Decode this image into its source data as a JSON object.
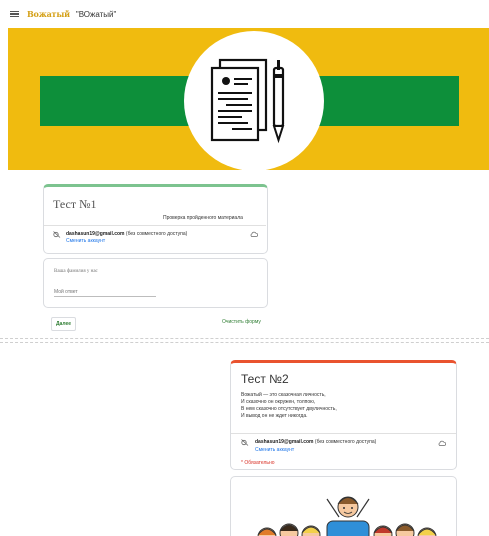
{
  "header": {
    "menu_icon": "hamburger-icon",
    "logo_text": "Вожатый",
    "title": "\"ВОжатый\""
  },
  "banner": {
    "bg_color": "#f0bb0f",
    "stripe_color": "#0d8f3a",
    "icon": "document-pen-icon"
  },
  "test1": {
    "title": "Тест №1",
    "description": "Проверка пройденного материала",
    "account": {
      "email": "dashasun19@gmail.com",
      "sharing": "(без совместного доступа)",
      "switch_label": "Сменить аккаунт"
    },
    "question": {
      "label": "Ваша фамилия у нас",
      "placeholder": "Мой ответ"
    },
    "next_button": "Далее",
    "clear_button": "Очистить форму",
    "accent_color": "#7cc38f"
  },
  "test2": {
    "title": "Тест №2",
    "lines": [
      "Вожатый — это сказочная личность,",
      "И сказочно он окружен, толпою,",
      "В нем сказочно отсутствует двуличность,",
      "И вывод он не ждет никогда."
    ],
    "account": {
      "email": "dashasun19@gmail.com",
      "sharing": "(без совместного доступа)",
      "switch_label": "Сменить аккаунт"
    },
    "required_label": "* Обязательно",
    "accent_color": "#e9532f"
  }
}
